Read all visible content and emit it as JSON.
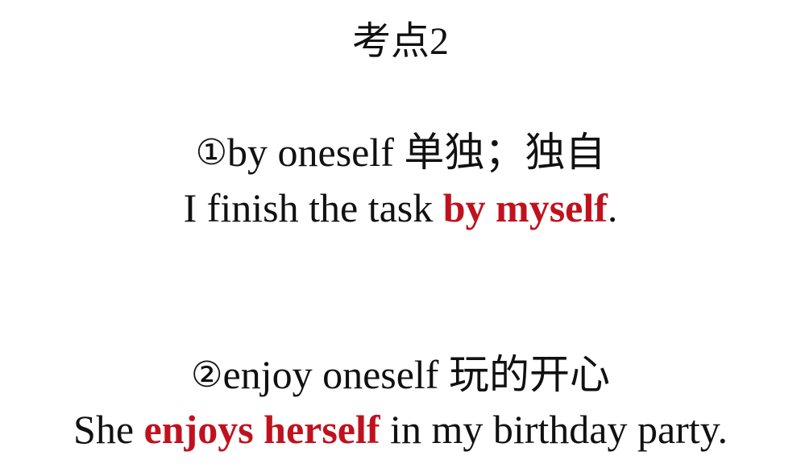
{
  "title": "考点2",
  "point1": {
    "number": "①",
    "phrase": "by oneself",
    "meaning": "单独；独自",
    "example_before": "I finish the task ",
    "example_highlight": "by myself",
    "example_after": "."
  },
  "point2": {
    "number": "②",
    "phrase": "enjoy oneself",
    "meaning": "玩的开心",
    "example_before": "She ",
    "example_highlight": "enjoys herself",
    "example_after": " in my birthday party."
  },
  "colors": {
    "highlight": "#c0121e",
    "text": "#111111",
    "background": "#ffffff"
  }
}
